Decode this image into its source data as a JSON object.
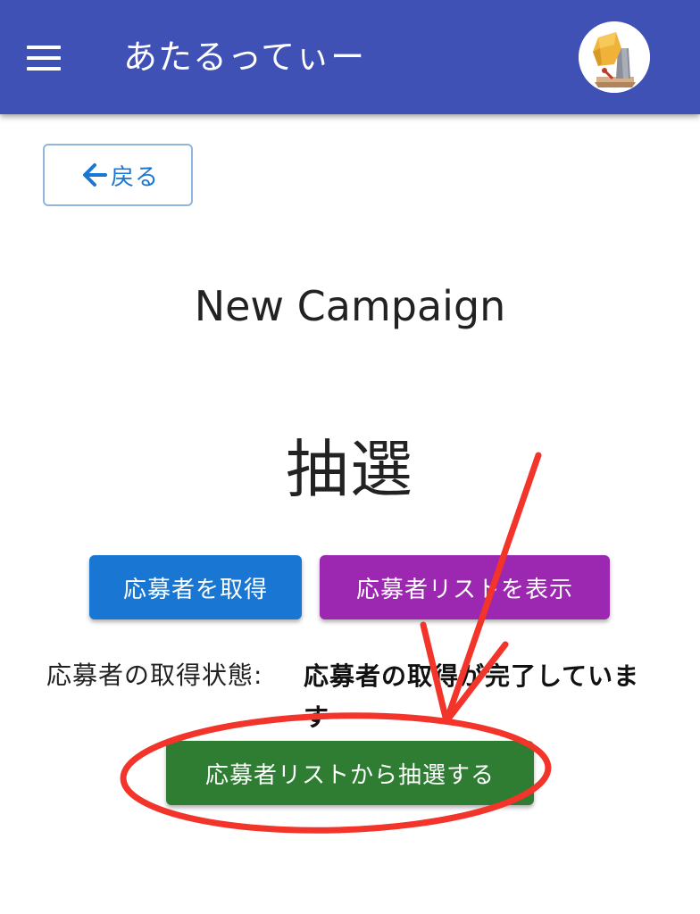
{
  "header": {
    "title": "あたるってぃー",
    "menu_icon": "hamburger-menu-icon",
    "avatar_icon": "lottery-machine-icon",
    "color": "#3f51b5"
  },
  "nav": {
    "back_label": "戻る",
    "back_icon": "arrow-left-icon"
  },
  "campaign": {
    "title": "New Campaign"
  },
  "section": {
    "heading": "抽選"
  },
  "actions": {
    "fetch_label": "応募者を取得",
    "show_list_label": "応募者リストを表示",
    "draw_label": "応募者リストから抽選する"
  },
  "status": {
    "label": "応募者の取得状態:",
    "value": "応募者の取得が完了しています"
  },
  "colors": {
    "fetch_button": "#1976d2",
    "show_list_button": "#9c27b0",
    "draw_button": "#2e7d32",
    "annotation": "#f2342a"
  }
}
